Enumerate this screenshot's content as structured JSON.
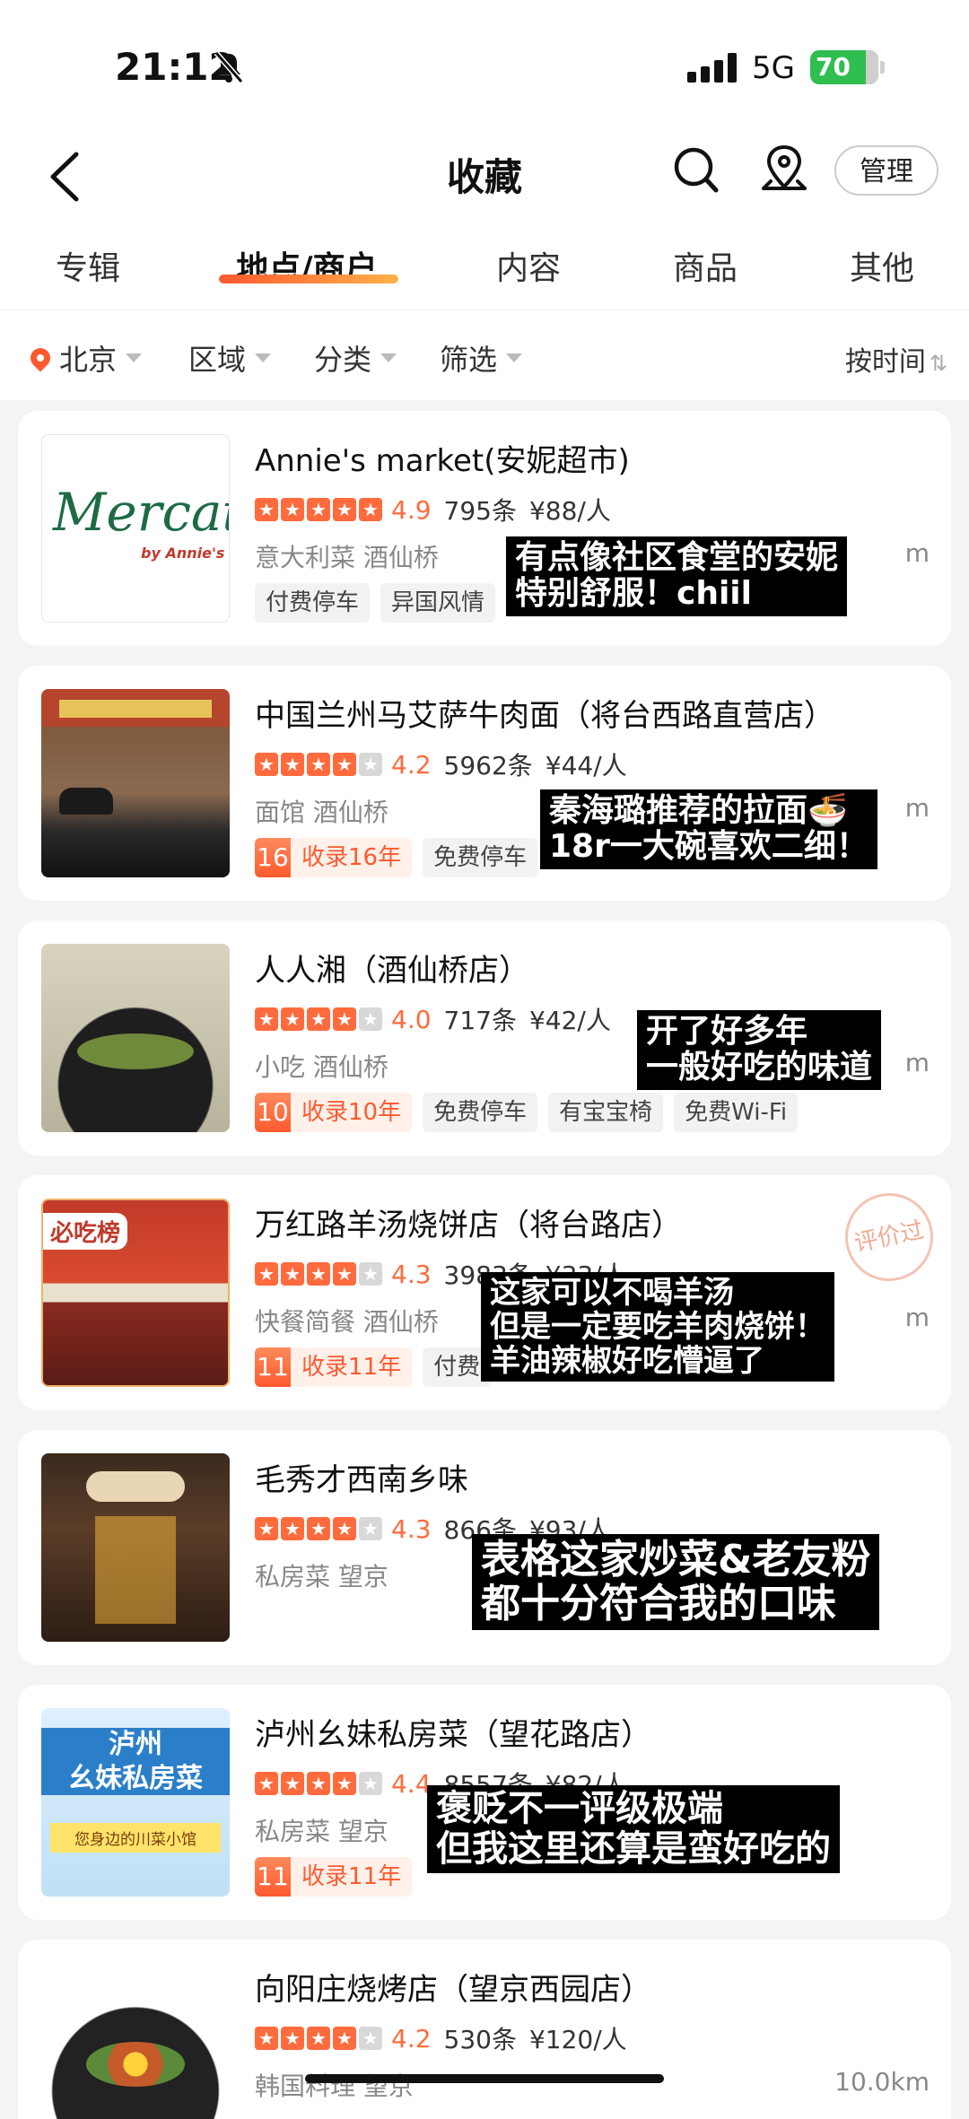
{
  "status": {
    "time": "21:12",
    "network": "5G",
    "battery": "70"
  },
  "nav": {
    "title": "收藏",
    "manage_label": "管理"
  },
  "tabs": [
    {
      "label": "专辑"
    },
    {
      "label": "地点/商户",
      "active": true
    },
    {
      "label": "内容"
    },
    {
      "label": "商品"
    },
    {
      "label": "其他"
    }
  ],
  "filters": {
    "city": "北京",
    "area": "区域",
    "category": "分类",
    "filter": "筛选",
    "sort": "按时间"
  },
  "colors": {
    "accent": "#ff5a2e",
    "star": "#ff6b3d"
  },
  "shops": [
    {
      "name": "Annie's market(安妮超市)",
      "stars": 5,
      "score": "4.9",
      "reviews": "795条",
      "price": "¥88/人",
      "meta": "意大利菜  酒仙桥",
      "dist": "m",
      "tags": [
        "付费停车",
        "异国风情"
      ],
      "thumb_logo": "Mercato",
      "thumb_logo_sub": "by Annie's",
      "note": "有点像社区食堂的安妮\n特别舒服！chiil"
    },
    {
      "name": "中国兰州马艾萨牛肉面（将台西路直营店）",
      "stars": 4,
      "score": "4.2",
      "reviews": "5962条",
      "price": "¥44/人",
      "meta": "面馆  酒仙桥",
      "dist": "m",
      "years_num": "16",
      "years_label": "收录16年",
      "tags": [
        "免费停车"
      ],
      "note": "秦海璐推荐的拉面🍜\n18r一大碗喜欢二细！"
    },
    {
      "name": "人人湘（酒仙桥店）",
      "stars": 4,
      "score": "4.0",
      "reviews": "717条",
      "price": "¥42/人",
      "meta": "小吃  酒仙桥",
      "dist": "m",
      "years_num": "10",
      "years_label": "收录10年",
      "tags": [
        "免费停车",
        "有宝宝椅",
        "免费Wi-Fi"
      ],
      "note": "开了好多年\n一般好吃的味道"
    },
    {
      "name": "万红路羊汤烧饼店（将台路店）",
      "stars": 4,
      "score": "4.3",
      "reviews": "3983条",
      "price": "¥33/人",
      "meta": "快餐简餐  酒仙桥",
      "dist": "m",
      "years_num": "11",
      "years_label": "收录11年",
      "tags": [
        "付费"
      ],
      "badge": "必吃榜",
      "stamp": "评价过",
      "note": "这家可以不喝羊汤\n但是一定要吃羊肉烧饼！\n羊油辣椒好吃懵逼了"
    },
    {
      "name": "毛秀才西南乡味",
      "stars": 4,
      "score": "4.3",
      "reviews": "866条",
      "price": "¥93/人",
      "meta": "私房菜  望京",
      "dist": "",
      "note": "表格这家炒菜&老友粉\n都十分符合我的口味"
    },
    {
      "name": "泸州幺妹私房菜（望花路店）",
      "stars": 4,
      "score": "4.4",
      "reviews": "8557条",
      "price": "¥82/人",
      "meta": "私房菜  望京",
      "dist": "",
      "years_num": "11",
      "years_label": "收录11年",
      "tags": [],
      "thumb_title": "泸州\n幺妹私房菜",
      "thumb_sub": "您身边的川菜小馆",
      "note": "褒贬不一评级极端\n但我这里还算是蛮好吃的"
    },
    {
      "name": "向阳庄烧烤店（望京西园店）",
      "stars": 4,
      "score": "4.2",
      "reviews": "530条",
      "price": "¥120/人",
      "meta": "韩国料理  望京",
      "dist": "10.0km",
      "note": ""
    }
  ]
}
